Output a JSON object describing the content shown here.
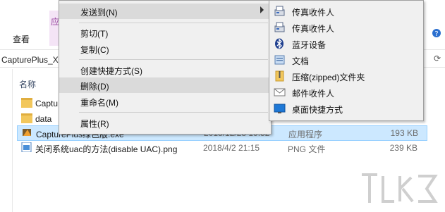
{
  "ribbon": {
    "view_tab": "查看",
    "context_tab": "应"
  },
  "address": {
    "path": "CapturePlus_X"
  },
  "columns": {
    "name": "名称"
  },
  "files": [
    {
      "name": "Captu",
      "date": "",
      "type": "",
      "size": "",
      "kind": "folder"
    },
    {
      "name": "data",
      "date": "",
      "type": "",
      "size": "",
      "kind": "folder"
    },
    {
      "name": "CapturePlus绿色版.exe",
      "date": "2018/12/28 19:52",
      "type": "应用程序",
      "size": "193 KB",
      "kind": "exe"
    },
    {
      "name": "关闭系统uac的方法(disable UAC).png",
      "date": "2018/4/2 21:15",
      "type": "PNG 文件",
      "size": "239 KB",
      "kind": "png"
    }
  ],
  "context_menu": {
    "send_to": "发送到(N)",
    "cut": "剪切(T)",
    "copy": "复制(C)",
    "create_shortcut": "创建快捷方式(S)",
    "delete": "删除(D)",
    "rename": "重命名(M)",
    "properties": "属性(R)"
  },
  "send_to_menu": [
    {
      "label": "传真收件人",
      "icon": "fax-icon"
    },
    {
      "label": "传真收件人",
      "icon": "fax-icon"
    },
    {
      "label": "蓝牙设备",
      "icon": "bluetooth-icon"
    },
    {
      "label": "文档",
      "icon": "document-icon"
    },
    {
      "label": "压缩(zipped)文件夹",
      "icon": "zip-folder-icon"
    },
    {
      "label": "邮件收件人",
      "icon": "mail-icon"
    },
    {
      "label": "桌面快捷方式",
      "icon": "desktop-icon"
    }
  ],
  "colors": {
    "highlight": "#dadada",
    "selection": "#cce8ff",
    "menu_bg": "#f0f0f0"
  }
}
